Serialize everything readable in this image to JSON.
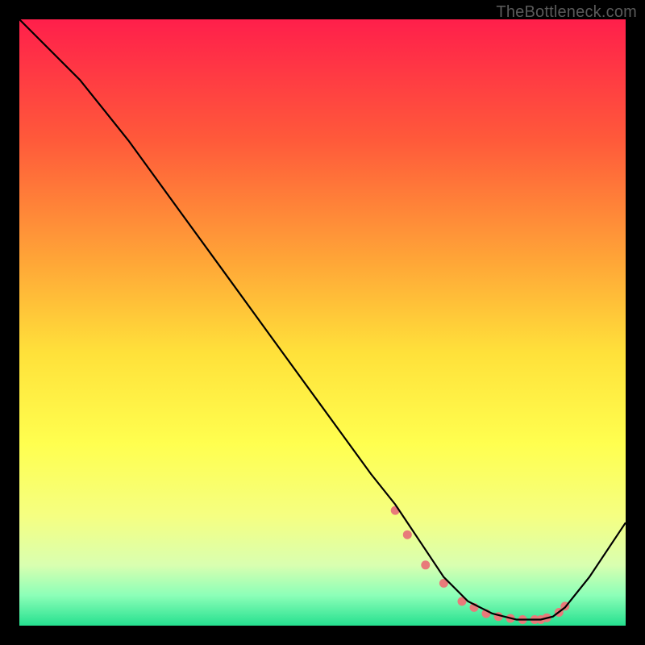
{
  "watermark": "TheBottleneck.com",
  "chart_data": {
    "type": "line",
    "title": "",
    "xlabel": "",
    "ylabel": "",
    "xlim": [
      0,
      100
    ],
    "ylim": [
      0,
      100
    ],
    "grid": false,
    "legend": false,
    "background_gradient_stops": [
      {
        "offset": 0.0,
        "color": "#ff1f4b"
      },
      {
        "offset": 0.2,
        "color": "#ff5a3a"
      },
      {
        "offset": 0.4,
        "color": "#ffa637"
      },
      {
        "offset": 0.55,
        "color": "#ffe13a"
      },
      {
        "offset": 0.7,
        "color": "#ffff4f"
      },
      {
        "offset": 0.82,
        "color": "#f5ff82"
      },
      {
        "offset": 0.9,
        "color": "#d9ffb0"
      },
      {
        "offset": 0.95,
        "color": "#8cffb8"
      },
      {
        "offset": 1.0,
        "color": "#25e08f"
      }
    ],
    "series": [
      {
        "name": "curve",
        "color": "#000000",
        "x": [
          0,
          4,
          10,
          18,
          26,
          34,
          42,
          50,
          58,
          62,
          66,
          70,
          74,
          78,
          82,
          86,
          88,
          90,
          94,
          100
        ],
        "y": [
          100,
          96,
          90,
          80,
          69,
          58,
          47,
          36,
          25,
          20,
          14,
          8,
          4,
          2,
          1,
          1,
          1.5,
          3,
          8,
          17
        ]
      }
    ],
    "markers": {
      "name": "highlight-points",
      "color": "#e87a7a",
      "radius": 5.5,
      "x": [
        62,
        64,
        67,
        70,
        73,
        75,
        77,
        79,
        81,
        83,
        85,
        86,
        87,
        89,
        90
      ],
      "y": [
        19,
        15,
        10,
        7,
        4,
        3,
        2,
        1.5,
        1.2,
        1,
        1,
        1,
        1.3,
        2.2,
        3.2
      ]
    }
  }
}
